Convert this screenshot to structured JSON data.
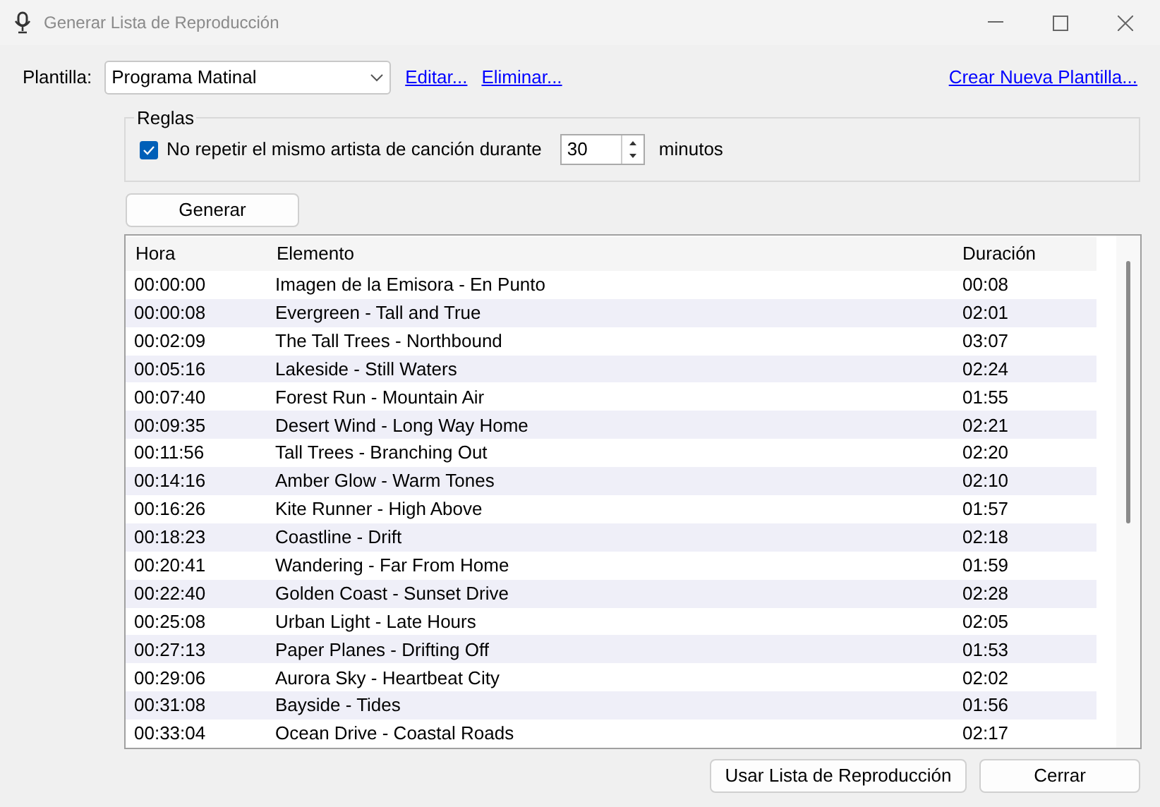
{
  "window": {
    "title": "Generar Lista de Reproducción"
  },
  "template": {
    "label": "Plantilla:",
    "value": "Programa Matinal",
    "links": [
      "Editar...",
      "Eliminar..."
    ],
    "create_link": "Crear Nueva Plantilla..."
  },
  "rules": {
    "title": "Reglas",
    "checkbox_label": "No repetir el mismo artista de canción durante",
    "checked": true,
    "minutes": "30",
    "unit": "minutos"
  },
  "generate_button": "Generar",
  "table": {
    "columns": [
      "Hora",
      "Elemento",
      "Duración"
    ],
    "rows": [
      [
        "00:00:00",
        "Imagen de la Emisora - En Punto",
        "00:08"
      ],
      [
        "00:00:08",
        "Evergreen - Tall and True",
        "02:01"
      ],
      [
        "00:02:09",
        "The Tall Trees - Northbound",
        "03:07"
      ],
      [
        "00:05:16",
        "Lakeside - Still Waters",
        "02:24"
      ],
      [
        "00:07:40",
        "Forest Run - Mountain Air",
        "01:55"
      ],
      [
        "00:09:35",
        "Desert Wind - Long Way Home",
        "02:21"
      ],
      [
        "00:11:56",
        "Tall Trees - Branching Out",
        "02:20"
      ],
      [
        "00:14:16",
        "Amber Glow - Warm Tones",
        "02:10"
      ],
      [
        "00:16:26",
        "Kite Runner - High Above",
        "01:57"
      ],
      [
        "00:18:23",
        "Coastline - Drift",
        "02:18"
      ],
      [
        "00:20:41",
        "Wandering - Far From Home",
        "01:59"
      ],
      [
        "00:22:40",
        "Golden Coast - Sunset Drive",
        "02:28"
      ],
      [
        "00:25:08",
        "Urban Light - Late Hours",
        "02:05"
      ],
      [
        "00:27:13",
        "Paper Planes - Drifting Off",
        "01:53"
      ],
      [
        "00:29:06",
        "Aurora Sky - Heartbeat City",
        "02:02"
      ],
      [
        "00:31:08",
        "Bayside - Tides",
        "01:56"
      ],
      [
        "00:33:04",
        "Ocean Drive - Coastal Roads",
        "02:17"
      ]
    ]
  },
  "buttons": [
    "Usar Lista de Reproducción",
    "Cerrar"
  ]
}
